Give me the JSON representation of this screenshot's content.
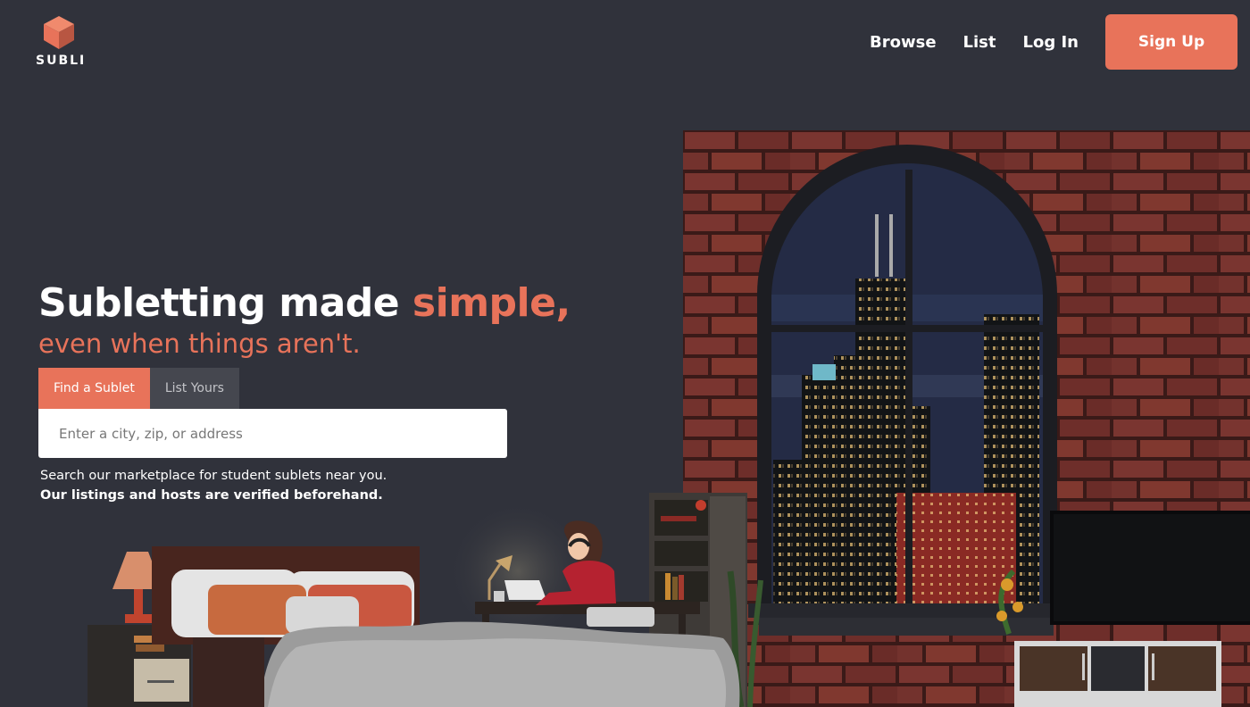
{
  "brand": {
    "name": "SUBLI",
    "icon": "cube-logo-icon",
    "accent_color": "#e8735a"
  },
  "nav": {
    "items": [
      "Browse",
      "List",
      "Log In"
    ],
    "signup_label": "Sign Up"
  },
  "hero": {
    "headline_main": "Subletting made ",
    "headline_accent": "simple,",
    "subheadline": "even when things aren't.",
    "tabs": [
      {
        "label": "Find a Sublet",
        "active": true
      },
      {
        "label": "List Yours",
        "active": false
      }
    ],
    "search_placeholder": "Enter a city, zip, or address",
    "description_line1": "Search our marketplace for student sublets near you.",
    "description_line2": "Our listings and hosts are verified beforehand."
  },
  "illustration": {
    "subject": "night-bedroom-scene",
    "colors": {
      "brick": "#7a3530",
      "sky": "#242b45"
    }
  }
}
